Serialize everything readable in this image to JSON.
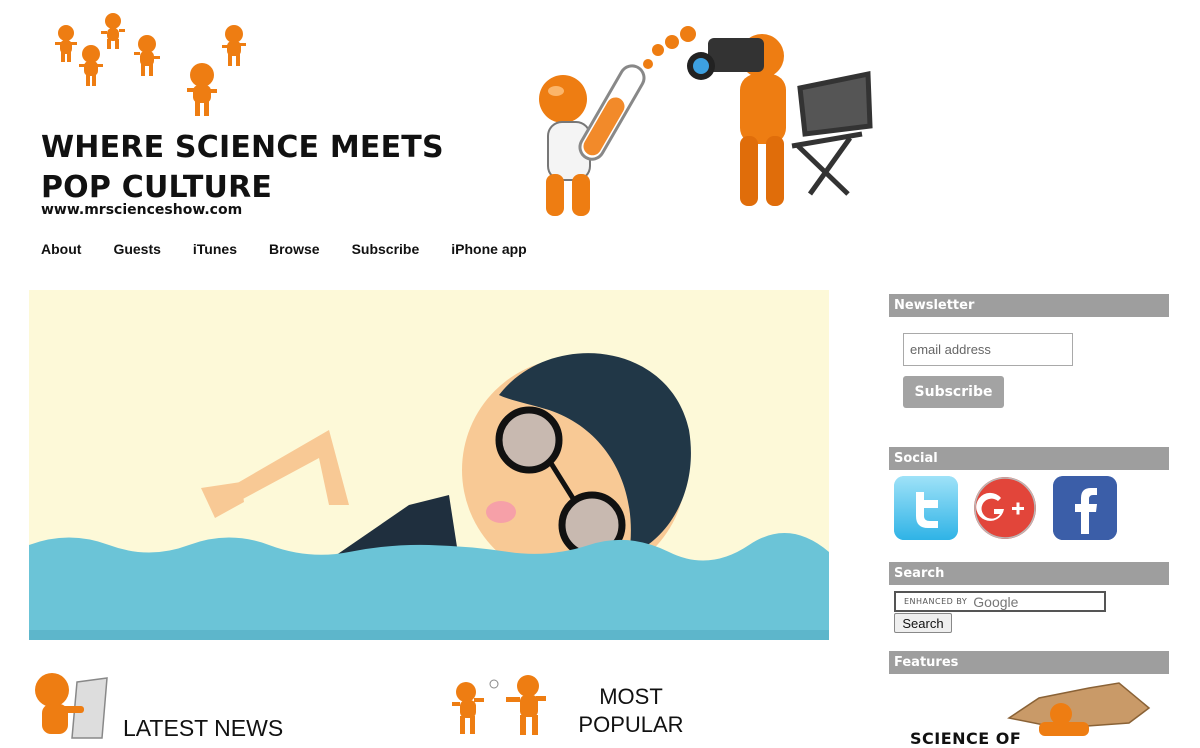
{
  "header": {
    "title_line1": "WHERE SCIENCE MEETS",
    "title_line2": "POP CULTURE",
    "url": "www.mrscienceshow.com"
  },
  "nav": {
    "items": [
      "About",
      "Guests",
      "iTunes",
      "Browse",
      "Subscribe",
      "iPhone app"
    ]
  },
  "sections": {
    "latest_news": "LATEST NEWS",
    "most_popular_line1": "MOST",
    "most_popular_line2": "POPULAR"
  },
  "sidebar": {
    "newsletter": {
      "heading": "Newsletter",
      "email_placeholder": "email address",
      "button_label": "Subscribe"
    },
    "social": {
      "heading": "Social",
      "icons": [
        "twitter-icon",
        "google-plus-icon",
        "facebook-icon"
      ]
    },
    "search": {
      "heading": "Search",
      "enhanced_by": "ENHANCED BY",
      "google": "Google",
      "button_label": "Search"
    },
    "features": {
      "heading": "Features",
      "caption": "SCIENCE OF"
    }
  },
  "colors": {
    "sidebar_heading_bg": "#9e9e9e",
    "button_bg": "#a3a3a3",
    "hero_bg": "#fdf9d8",
    "water": "#6bc4d7",
    "figure_orange": "#ee7d12"
  }
}
